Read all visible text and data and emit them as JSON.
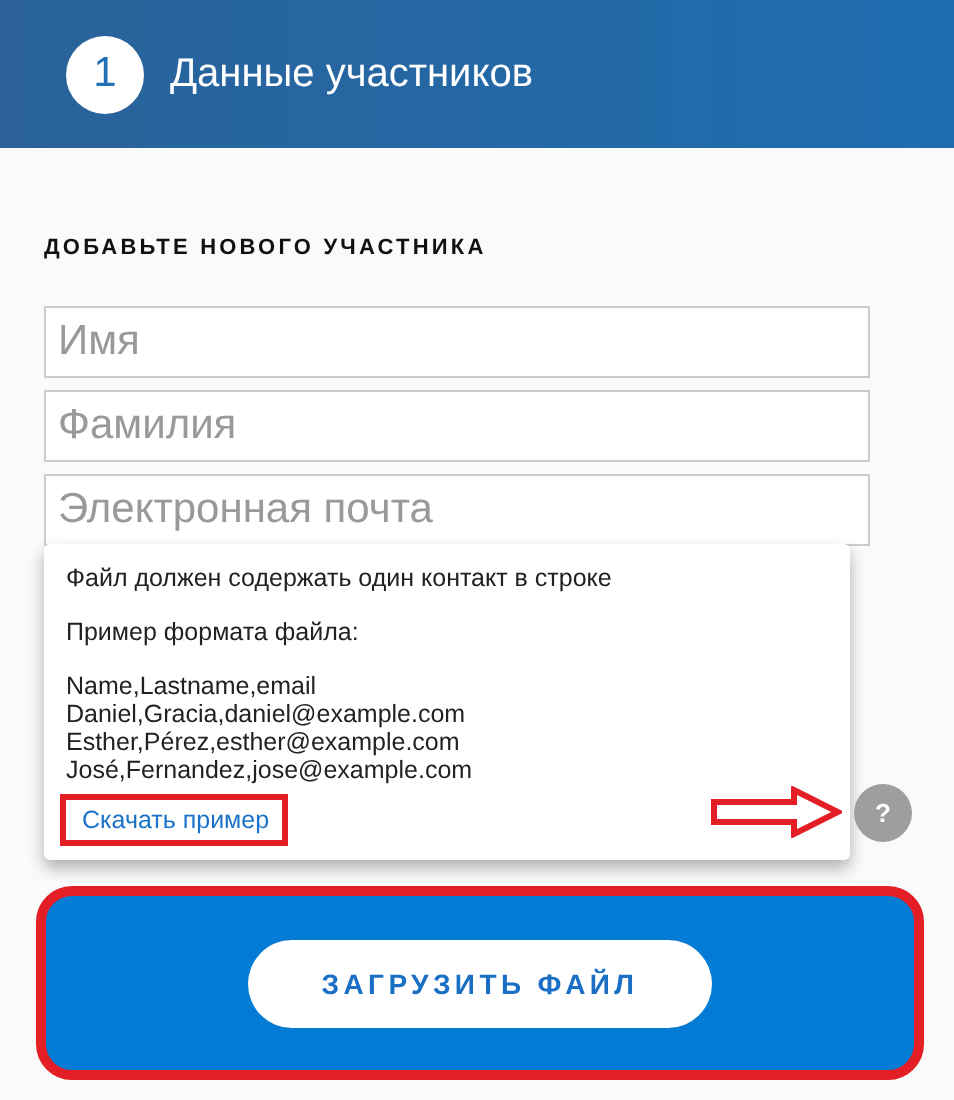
{
  "header": {
    "step": "1",
    "title": "Данные участников"
  },
  "section_title": "ДОБАВЬТЕ НОВОГО УЧАСТНИКА",
  "fields": [
    {
      "placeholder": "Имя"
    },
    {
      "placeholder": "Фамилия"
    },
    {
      "placeholder": "Электронная почта"
    }
  ],
  "tooltip": {
    "text": "Файл должен содержать один контакт в строке",
    "format_label": "Пример формата файла:",
    "example_lines": [
      "Name,Lastname,email",
      "Daniel,Gracia,daniel@example.com",
      "Esther,Pérez,esther@example.com",
      "José,Fernandez,jose@example.com"
    ],
    "link": "Скачать пример"
  },
  "help_button": "?",
  "upload_button": "ЗАГРУЗИТЬ ФАЙЛ"
}
